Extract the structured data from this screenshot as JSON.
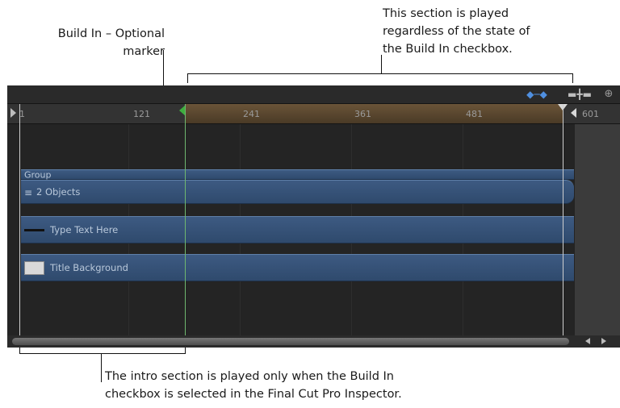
{
  "callouts": {
    "build_in_line1": "Build In – Optional",
    "build_in_line2": "marker",
    "section_line1": "This section is played",
    "section_line2": "regardless of the state of",
    "section_line3": "the Build In checkbox.",
    "intro_line1": "The intro section is played only when the Build In",
    "intro_line2": "checkbox is selected in the Final Cut Pro Inspector."
  },
  "ruler": {
    "ticks": [
      "1",
      "121",
      "241",
      "361",
      "481",
      "601"
    ]
  },
  "tracks": {
    "group_label": "Group",
    "objects_label": "2 Objects",
    "text_layer_label": "Type Text Here",
    "background_layer_label": "Title Background"
  },
  "icons": {
    "toolbar": [
      "keyframe-icon",
      "split-icon",
      "zoom-icon"
    ],
    "ruler": [
      "play-start-icon",
      "play-end-icon",
      "build-in-marker-icon",
      "out-marker-icon"
    ],
    "scroll": [
      "scroll-left-icon",
      "scroll-right-icon"
    ]
  },
  "colors": {
    "track": "#355075",
    "build_in_marker": "#3fae3f",
    "play_range": "#5a4630"
  }
}
